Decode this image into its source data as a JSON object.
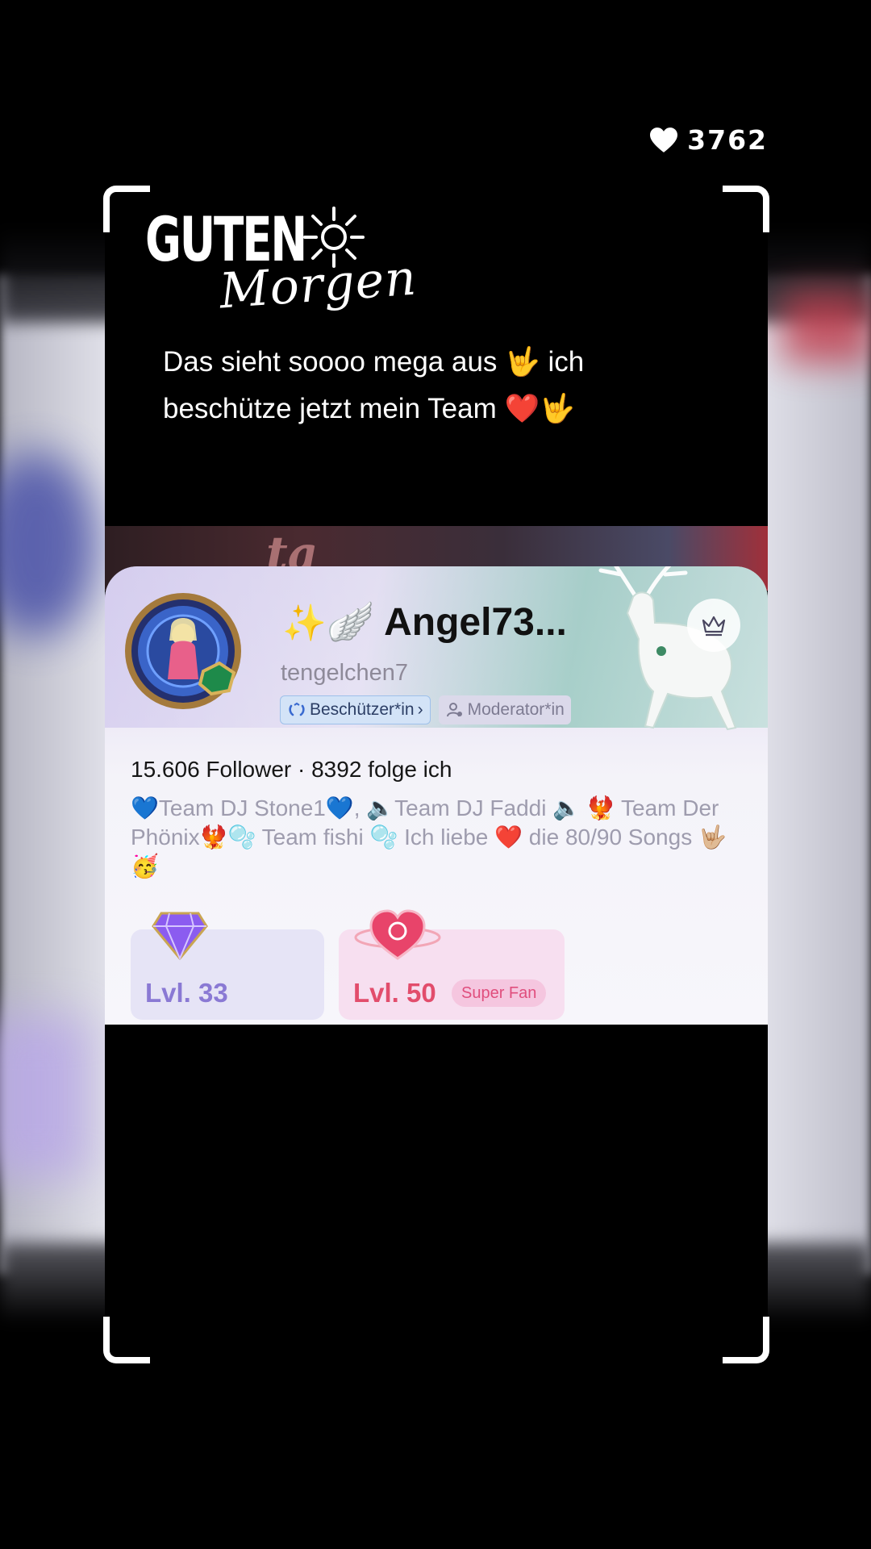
{
  "likes": {
    "icon": "heart-icon",
    "count": "3762"
  },
  "overlay_text": {
    "line1": "GUTEN",
    "line2": "Morgen"
  },
  "comment": {
    "text": "Das sieht soooo mega aus 🤟 ich beschütze jetzt mein Team ❤️🤟"
  },
  "banner": {
    "text": "ta"
  },
  "profile": {
    "display_name": "Angel73...",
    "display_prefix": "✨",
    "wing": "🪽",
    "username": "tengelchen7",
    "badges": [
      {
        "label": "Beschützer*in",
        "icon": "shield-icon",
        "chevron": "›"
      },
      {
        "label": "Moderator*in",
        "icon": "moderator-icon"
      }
    ],
    "follow_line": "15.606 Follower · 8392 folge ich",
    "bio_parts": {
      "p1": "💙",
      "p2": "Team DJ Stone1",
      "p3": "💙",
      "p4": ", 🔈Team DJ Faddi 🔈 🐦‍🔥 Team Der Phönix",
      "p5": "🐦‍🔥🫧 Team fishi 🫧 Ich liebe ",
      "p6": "❤️",
      "p7": " die 80/90 Songs 🤟🏼🥳"
    }
  },
  "levels": [
    {
      "label": "Lvl. 33",
      "icon": "diamond-gem-icon"
    },
    {
      "label": "Lvl. 50",
      "icon": "heart-orbit-icon",
      "tag": "Super Fan"
    }
  ],
  "colors": {
    "accent_purple": "#8a79d4",
    "accent_pink": "#e24d6c",
    "badge_blue": "#d3e3f7"
  }
}
